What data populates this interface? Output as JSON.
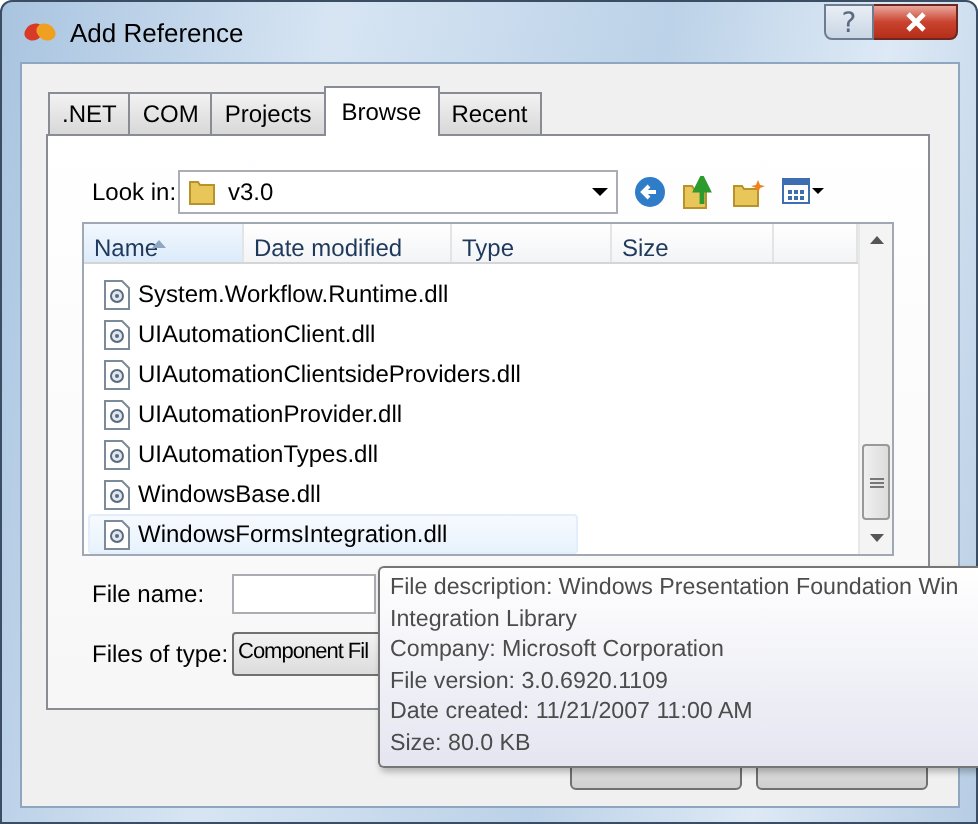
{
  "window": {
    "title": "Add Reference",
    "help": "?"
  },
  "tabs": [
    {
      "label": ".NET",
      "selected": false
    },
    {
      "label": "COM",
      "selected": false
    },
    {
      "label": "Projects",
      "selected": false
    },
    {
      "label": "Browse",
      "selected": true
    },
    {
      "label": "Recent",
      "selected": false
    }
  ],
  "look_in": {
    "label": "Look in:",
    "value": "v3.0"
  },
  "columns": [
    "Name",
    "Date modified",
    "Type",
    "Size"
  ],
  "files": [
    {
      "name": "System.Workflow.Runtime.dll",
      "highlighted": false
    },
    {
      "name": "UIAutomationClient.dll",
      "highlighted": false
    },
    {
      "name": "UIAutomationClientsideProviders.dll",
      "highlighted": false
    },
    {
      "name": "UIAutomationProvider.dll",
      "highlighted": false
    },
    {
      "name": "UIAutomationTypes.dll",
      "highlighted": false
    },
    {
      "name": "WindowsBase.dll",
      "highlighted": false
    },
    {
      "name": "WindowsFormsIntegration.dll",
      "highlighted": true
    }
  ],
  "file_name": {
    "label": "File name:"
  },
  "file_type": {
    "label": "Files of type:",
    "value": "Component Fil"
  },
  "buttons": [
    {
      "kind": "push"
    },
    {
      "kind": "push"
    }
  ],
  "tooltip": {
    "lines": [
      "File description: Windows Presentation Foundation Win",
      "Integration Library",
      "Company: Microsoft Corporation",
      "File version: 3.0.6920.1109",
      "Date created: 11/21/2007 11:00 AM",
      "Size: 80.0 KB"
    ]
  }
}
